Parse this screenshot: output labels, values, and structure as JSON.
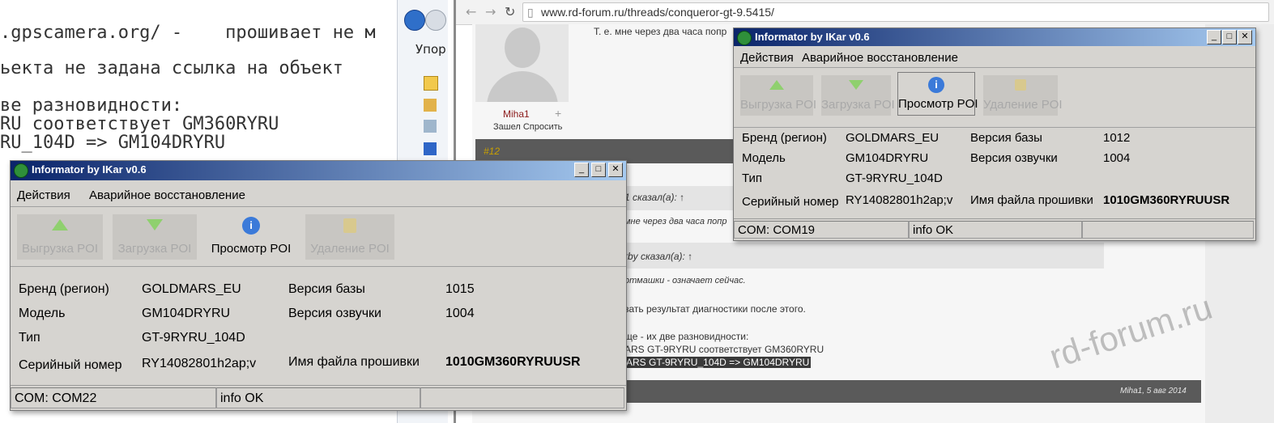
{
  "editor": {
    "lines": [
      ".gpscamera.org/ -    прошивает не м",
      "ьекта не задана ссылка на объект",
      "ве разновидности:",
      "RU соответствует GM360RYRU",
      "RU_104D => GM104DRYRU"
    ]
  },
  "explorer": {
    "organize_label": "Упор"
  },
  "browser": {
    "url": "www.rd-forum.ru/threads/conqueror-gt-9.5415/",
    "forum": {
      "post_text_1": "Т. е. мне через два часа попр",
      "user_name": "Miha1",
      "user_status": "Зашел Спросить",
      "post_number": "#12",
      "quote_head_1": "1 сказал(а): ↑",
      "quote_text_1": "мне через два часа попр",
      "quote_head_2": "rby сказал(а): ↑",
      "quote_text_2": "отмашки - означает сейчас.",
      "line_1": "зать результат диагностики после этого.",
      "line_2": "ще - их две разновидности:",
      "line_3": "ARS GT-9RYRU соответствует GM360RYRU",
      "line_4": "ARS GT-9RYRU_104D => GM104DRYRU",
      "footer_meta": "Miha1, 5 авг 2014"
    }
  },
  "watermark": "rd-forum.ru",
  "window_left": {
    "title": "Informator by IKar v0.6",
    "menu": [
      "Действия",
      "Аварийное восстановление"
    ],
    "tools": [
      "Выгрузка POI",
      "Загрузка POI",
      "Просмотр POI",
      "Удаление POI"
    ],
    "fields": {
      "brand_label": "Бренд (регион)",
      "brand_value": "GOLDMARS_EU",
      "model_label": "Модель",
      "model_value": "GM104DRYRU",
      "type_label": "Тип",
      "type_value": "GT-9RYRU_104D",
      "serial_label": "Серийный номер",
      "serial_value": "RY14082801h2ap;v",
      "db_label": "Версия базы",
      "db_value": "1015",
      "voice_label": "Версия озвучки",
      "voice_value": "1004",
      "fw_label": "Имя файла прошивки",
      "fw_value": "1010GM360RYRUUSR"
    },
    "status": {
      "com": "COM: COM22",
      "info": "info OK",
      "extra": ""
    }
  },
  "window_right": {
    "title": "Informator by IKar v0.6",
    "menu": [
      "Действия",
      "Аварийное восстановление"
    ],
    "tools": [
      "Выгрузка POI",
      "Загрузка POI",
      "Просмотр POI",
      "Удаление POI"
    ],
    "fields": {
      "brand_label": "Бренд (регион)",
      "brand_value": "GOLDMARS_EU",
      "model_label": "Модель",
      "model_value": "GM104DRYRU",
      "type_label": "Тип",
      "type_value": "GT-9RYRU_104D",
      "serial_label": "Серийный номер",
      "serial_value": "RY14082801h2ap;v",
      "db_label": "Версия базы",
      "db_value": "1012",
      "voice_label": "Версия озвучки",
      "voice_value": "1004",
      "fw_label": "Имя файла прошивки",
      "fw_value": "1010GM360RYRUUSR"
    },
    "status": {
      "com": "COM: COM19",
      "info": "info OK",
      "extra": ""
    }
  },
  "colors": {
    "title_gradient_start": "#0a246a",
    "title_gradient_end": "#a6caf0",
    "window_bg": "#d6d4d0",
    "arrow_green": "#6fbf4a",
    "info_blue": "#3b7ad9",
    "forum_dark": "#5a5a5a",
    "post_number": "#c9a000"
  }
}
